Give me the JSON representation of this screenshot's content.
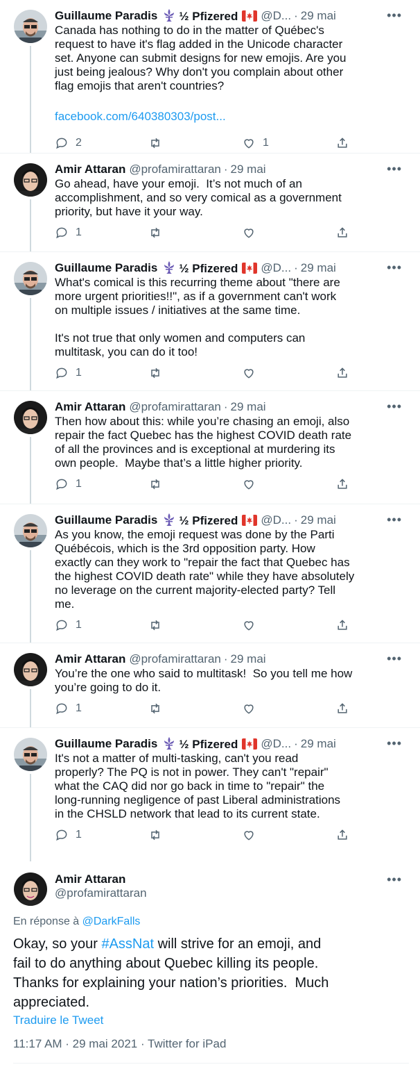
{
  "thread": [
    {
      "author": "Guillaume Paradis",
      "name_suffix": "½ Pfizered",
      "handle": "@D...",
      "time": "29 mai",
      "text": "Canada has nothing to do in the matter of Québec's\nrequest to have it's flag added in the Unicode character\nset. Anyone can submit designs for new emojis. Are you\njust being jealous? Why don't you complain about other\nflag emojis that aren't countries?",
      "link": "facebook.com/640380303/post...",
      "replies": "2",
      "retweets": "",
      "likes": "1"
    },
    {
      "author": "Amir Attaran",
      "handle": "@profamirattaran",
      "time": "29 mai",
      "text": "Go ahead, have your emoji.  It’s not much of an\naccomplishment, and so very comical as a government\npriority, but have it your way.",
      "replies": "1",
      "retweets": "",
      "likes": ""
    },
    {
      "author": "Guillaume Paradis",
      "name_suffix": "½ Pfizered",
      "handle": "@D...",
      "time": "29 mai",
      "text": "What's comical is this recurring theme about \"there are\nmore urgent priorities!!\", as if a government can't work\non multiple issues / initiatives at the same time.\n\nIt's not true that only women and computers can\nmultitask, you can do it too!",
      "replies": "1",
      "retweets": "",
      "likes": ""
    },
    {
      "author": "Amir Attaran",
      "handle": "@profamirattaran",
      "time": "29 mai",
      "text": "Then how about this: while you’re chasing an emoji, also\nrepair the fact Quebec has the highest COVID death rate\nof all the provinces and is exceptional at murdering its\nown people.  Maybe that’s a little higher priority.",
      "replies": "1",
      "retweets": "",
      "likes": ""
    },
    {
      "author": "Guillaume Paradis",
      "name_suffix": "½ Pfizered",
      "handle": "@D...",
      "time": "29 mai",
      "text": "As you know, the emoji request was done by the Parti\nQuébécois, which is the 3rd opposition party. How\nexactly can they work to \"repair the fact that Quebec has\nthe highest COVID death rate\" while they have absolutely\nno leverage on the current majority-elected party? Tell\nme.",
      "replies": "1",
      "retweets": "",
      "likes": ""
    },
    {
      "author": "Amir Attaran",
      "handle": "@profamirattaran",
      "time": "29 mai",
      "text": "You’re the one who said to multitask!  So you tell me how\nyou’re going to do it.",
      "replies": "1",
      "retweets": "",
      "likes": ""
    },
    {
      "author": "Guillaume Paradis",
      "name_suffix": "½ Pfizered",
      "handle": "@D...",
      "time": "29 mai",
      "text": "It's not a matter of multi-tasking, can't you read\nproperly? The PQ is not in power. They can't \"repair\"\nwhat the CAQ did nor go back in time to \"repair\" the\nlong-running negligence of past Liberal administrations\nin the CHSLD network that lead to its current state.",
      "replies": "1",
      "retweets": "",
      "likes": ""
    }
  ],
  "focal": {
    "author": "Amir Attaran",
    "handle": "@profamirattaran",
    "reply_prefix": "En réponse à ",
    "reply_to": "@DarkFalls",
    "text_before": "Okay, so your ",
    "hashtag": "#AssNat",
    "text_after": " will strive for an emoji, and\nfail to do anything about Quebec killing its people.\nThanks for explaining your nation’s priorities.  Much\nappreciated.",
    "translate": "Traduire le Tweet",
    "meta": "11:17 AM · 29 mai 2021 · Twitter for iPad"
  },
  "icons": {
    "reply": "reply-icon",
    "retweet": "retweet-icon",
    "like": "like-icon",
    "share": "share-icon",
    "more": "more-icon",
    "fleur_de_lis": "fleur-de-lis-icon",
    "flag": "canada-flag-icon"
  },
  "colors": {
    "link": "#1d9bf0",
    "secondary": "#536471",
    "thread_line": "#cfd9de"
  }
}
